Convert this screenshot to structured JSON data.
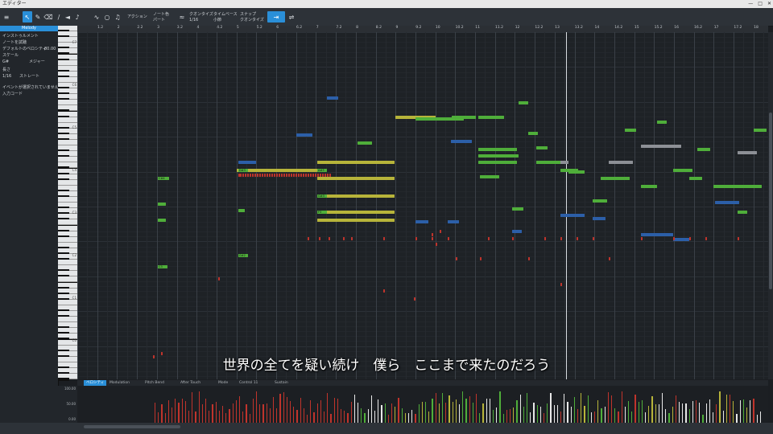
{
  "window": {
    "title": "エディター",
    "controls": [
      "—",
      "□",
      "✕"
    ]
  },
  "toolbar": {
    "menu_icon": "menu-icon",
    "action_label": "アクション",
    "note_color_label": "ノート色",
    "note_color_value": "パート",
    "quantize_label": "クオンタイズ",
    "quantize_value": "1/16",
    "timebase_label": "タイムベース",
    "timebase_value": "小節",
    "snap_label": "スナップ",
    "snap_value": "クオンタイズ"
  },
  "sidebar": {
    "track_name": "Melody",
    "instrument_label": "インストゥルメント",
    "note_display_label": "ノートを試聴",
    "default_velocity_label": "デフォルトのベロシティ",
    "default_velocity_value": "80.00",
    "scale_label": "スケール",
    "scale_key": "G#",
    "scale_type": "メジャー",
    "length_label": "長さ",
    "length_value": "1/16",
    "length_mode": "ストレート",
    "no_event_msg": "イベントが選択されていません",
    "input_chord": "入力コード"
  },
  "ruler": {
    "marks": [
      "1.2",
      "2",
      "2.2",
      "3",
      "3.2",
      "4",
      "4.2",
      "5",
      "5.2",
      "6",
      "6.2",
      "7",
      "7.2",
      "8",
      "8.2",
      "9",
      "9.2",
      "10",
      "10.2",
      "11",
      "11.2",
      "12",
      "12.2",
      "13",
      "13.2",
      "14",
      "14.2",
      "15",
      "15.2",
      "16",
      "16.2",
      "17",
      "17.2",
      "18"
    ]
  },
  "piano": {
    "octave_labels": [
      "C7",
      "C6",
      "C5",
      "C4",
      "C3",
      "C2",
      "C1",
      "C0"
    ]
  },
  "lyric": "世界の全てを疑い続け　僕ら　ここまで来たのだろう",
  "notes_sample": [
    "C#4",
    "A#3",
    "G#3",
    "F3",
    "D#3",
    "C3",
    "G#2"
  ],
  "lower": {
    "tabs": [
      "ベロシティ",
      "Modulation",
      "Pitch Bend",
      "After Touch",
      "Mode",
      "Control 11",
      "Sustain"
    ],
    "scale": [
      "100.00",
      "50.00",
      "0.00"
    ]
  },
  "colors": {
    "accent": "#2a8fd8",
    "note_green": "#4fae3a",
    "note_yellow": "#b7b43a",
    "note_blue": "#2c5fa8",
    "note_red": "#c0342c",
    "note_gray": "#8d9096"
  }
}
